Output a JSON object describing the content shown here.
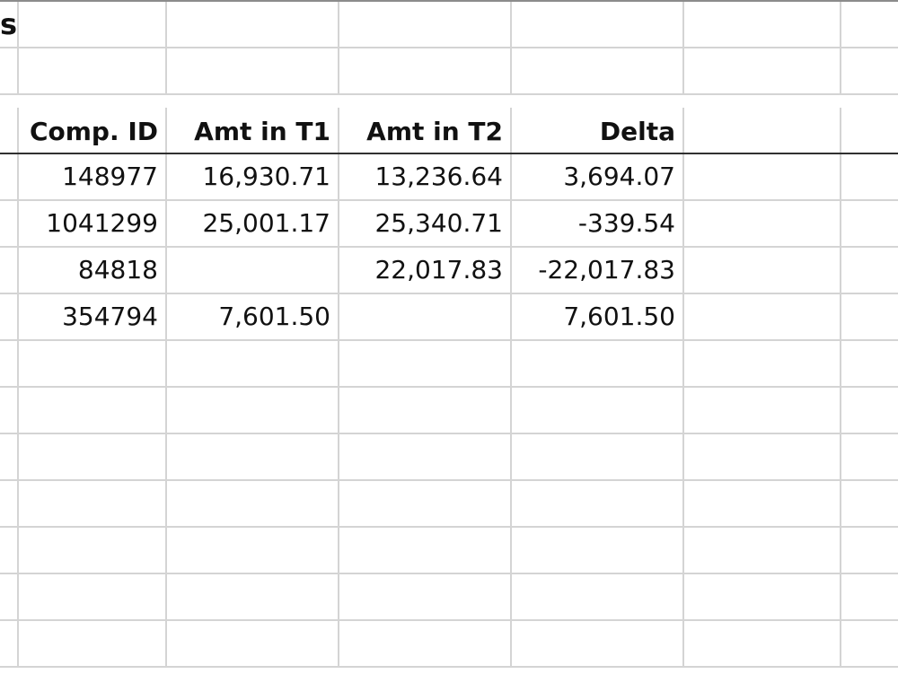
{
  "sheet": {
    "title_fragment": "s",
    "headers": [
      "Comp. ID",
      "Amt in T1",
      "Amt in T2",
      "Delta"
    ],
    "rows": [
      [
        "148977",
        "16,930.71",
        "13,236.64",
        "3,694.07"
      ],
      [
        "1041299",
        "25,001.17",
        "25,340.71",
        "-339.54"
      ],
      [
        "84818",
        "",
        "22,017.83",
        "-22,017.83"
      ],
      [
        "354794",
        "7,601.50",
        "",
        "7,601.50"
      ]
    ]
  }
}
